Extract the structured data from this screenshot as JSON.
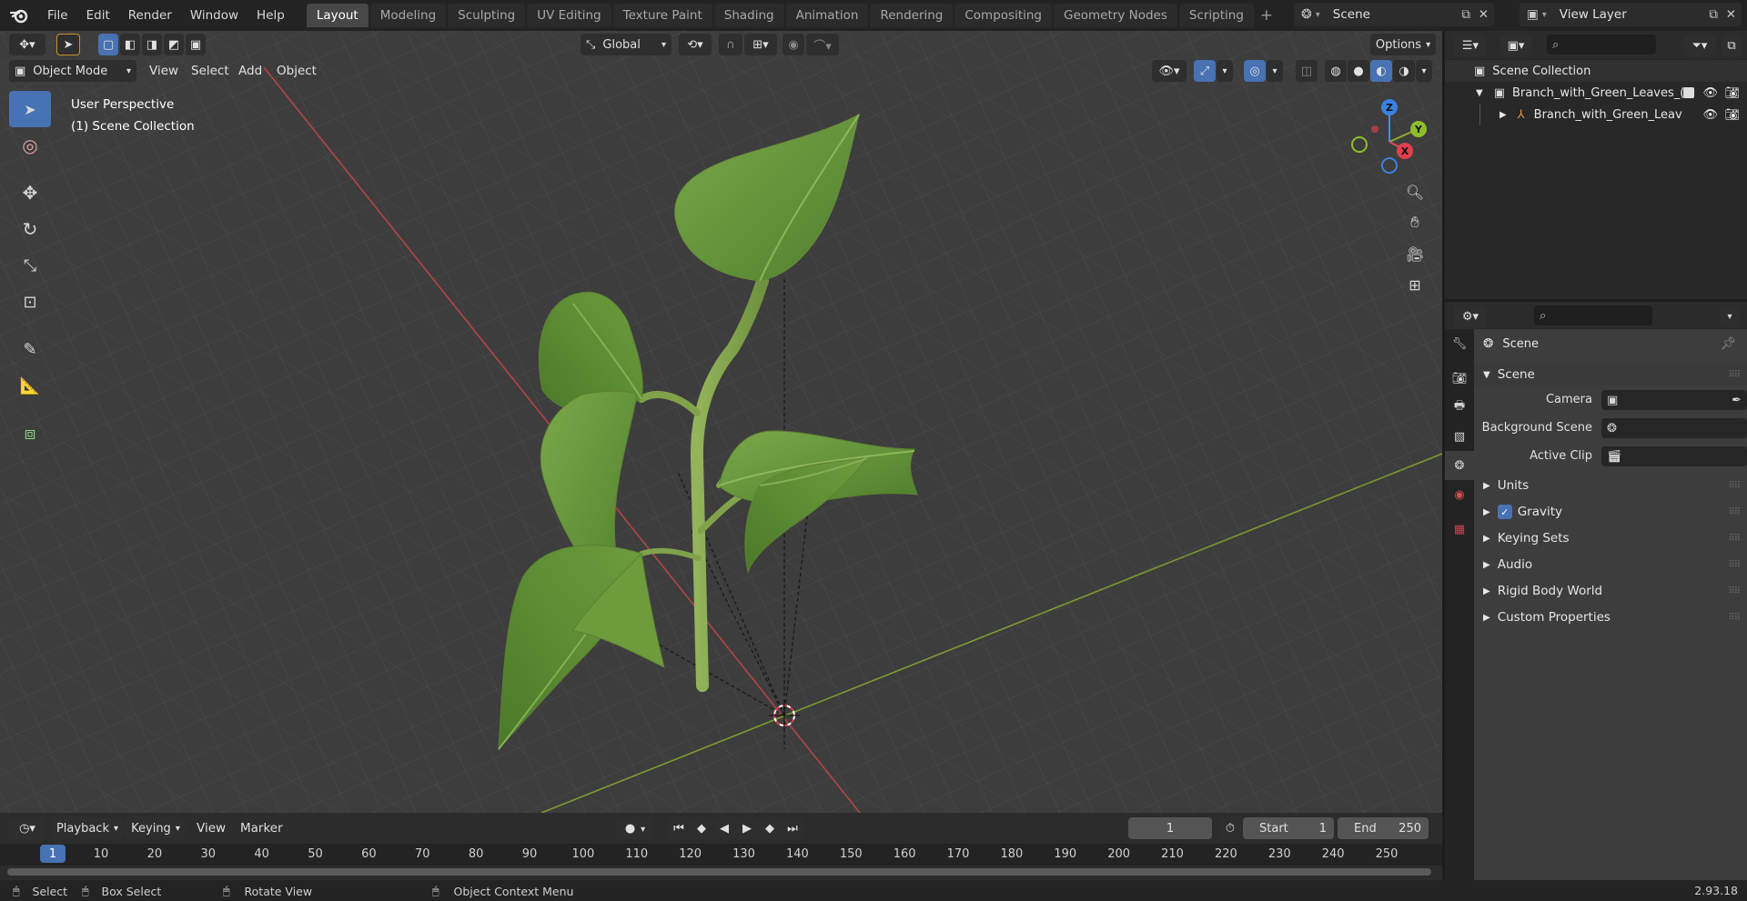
{
  "app": {
    "menu": [
      "File",
      "Edit",
      "Render",
      "Window",
      "Help"
    ],
    "workspaces": [
      "Layout",
      "Modeling",
      "Sculpting",
      "UV Editing",
      "Texture Paint",
      "Shading",
      "Animation",
      "Rendering",
      "Compositing",
      "Geometry Nodes",
      "Scripting"
    ],
    "active_workspace": "Layout",
    "scene_name": "Scene",
    "view_layer": "View Layer",
    "version": "2.93.18"
  },
  "viewport": {
    "mode": "Object Mode",
    "header_menus": [
      "View",
      "Select",
      "Add",
      "Object"
    ],
    "orientation": "Global",
    "options_label": "Options",
    "overlay_title": "User Perspective",
    "overlay_subtitle": "(1) Scene Collection",
    "gizmo": {
      "x": "X",
      "y": "Y",
      "z": "Z"
    }
  },
  "outliner": {
    "root": "Scene Collection",
    "collection": "Branch_with_Green_Leaves_(",
    "object": "Branch_with_Green_Leav"
  },
  "properties": {
    "context": "Scene",
    "panel": "Scene",
    "fields": [
      {
        "label": "Camera",
        "value": ""
      },
      {
        "label": "Background Scene",
        "value": ""
      },
      {
        "label": "Active Clip",
        "value": ""
      }
    ],
    "subpanels": [
      "Units",
      "Gravity",
      "Keying Sets",
      "Audio",
      "Rigid Body World",
      "Custom Properties"
    ],
    "gravity_checked": true
  },
  "timeline": {
    "menus": [
      "Playback",
      "Keying",
      "View",
      "Marker"
    ],
    "current_frame": "1",
    "start_label": "Start",
    "start": "1",
    "end_label": "End",
    "end": "250",
    "ruler_ticks": [
      "1",
      "10",
      "20",
      "30",
      "40",
      "50",
      "60",
      "70",
      "80",
      "90",
      "100",
      "110",
      "120",
      "130",
      "140",
      "150",
      "160",
      "170",
      "180",
      "190",
      "200",
      "210",
      "220",
      "230",
      "240",
      "250"
    ]
  },
  "statusbar": {
    "select": "Select",
    "box_select": "Box Select",
    "rotate": "Rotate View",
    "context_menu": "Object Context Menu"
  }
}
